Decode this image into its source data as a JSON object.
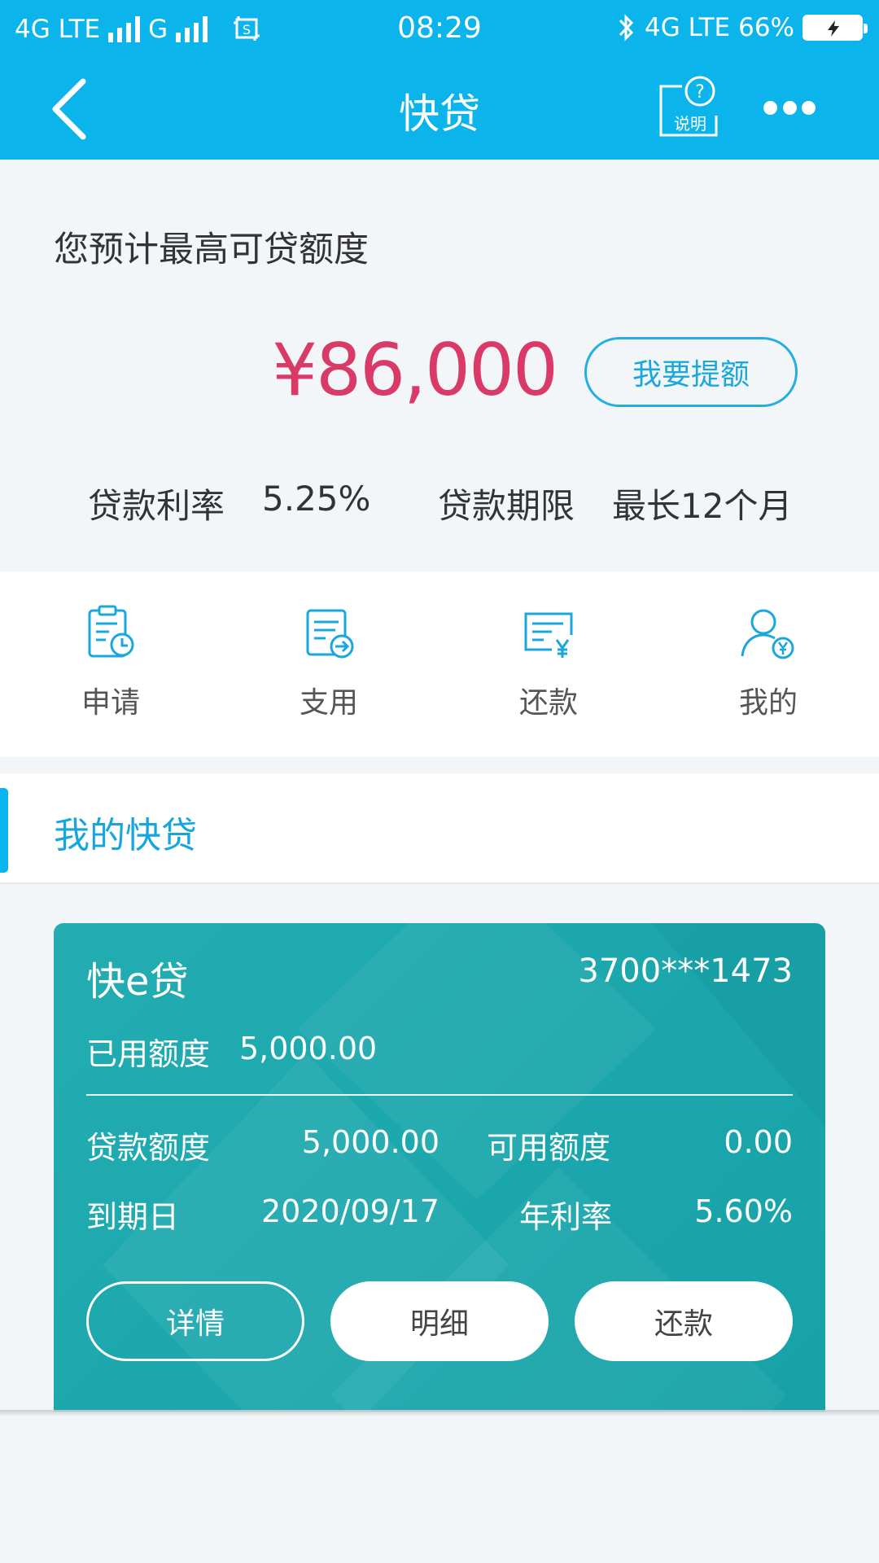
{
  "status_bar": {
    "network1": "4G LTE",
    "network2": "G",
    "time": "08:29",
    "network3": "4G LTE",
    "battery": "66%"
  },
  "header": {
    "title": "快贷",
    "help_label": "说明"
  },
  "quota": {
    "title": "您预计最高可贷额度",
    "amount": "¥86,000",
    "raise_button": "我要提额",
    "rate_label": "贷款利率",
    "rate_value": "5.25%",
    "term_label": "贷款期限",
    "term_value": "最长12个月"
  },
  "quick_menu": [
    {
      "label": "申请",
      "icon": "application-clock-icon"
    },
    {
      "label": "支用",
      "icon": "withdraw-arrow-icon"
    },
    {
      "label": "还款",
      "icon": "repay-yen-icon"
    },
    {
      "label": "我的",
      "icon": "user-yen-icon"
    }
  ],
  "section": {
    "title": "我的快贷"
  },
  "loan_card": {
    "name": "快e贷",
    "account": "3700***1473",
    "used_label": "已用额度",
    "used_value": "5,000.00",
    "loan_amount_label": "贷款额度",
    "loan_amount_value": "5,000.00",
    "available_label": "可用额度",
    "available_value": "0.00",
    "due_label": "到期日",
    "due_value": "2020/09/17",
    "apr_label": "年利率",
    "apr_value": "5.60%",
    "buttons": {
      "detail": "详情",
      "statement": "明细",
      "repay": "还款"
    }
  },
  "colors": {
    "primary": "#0cb4ec",
    "amount": "#d93a68",
    "card": "#1fa9ae",
    "background": "#f2f6f9"
  }
}
